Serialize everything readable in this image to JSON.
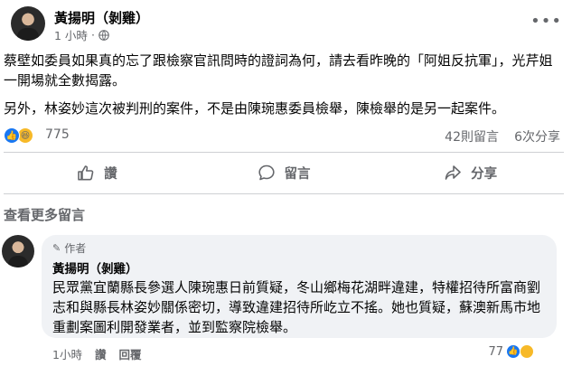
{
  "post": {
    "author": "黃揚明（剝雞）",
    "time": "1 小時",
    "paragraph1": "蔡壁如委員如果真的忘了跟檢察官訊問時的證詞為何，請去看昨晚的「阿姐反抗軍」，光芹姐一開場就全數揭露。",
    "paragraph2": "另外，林姿妙這次被判刑的案件，不是由陳琬惠委員檢舉，陳檢舉的是另一起案件。"
  },
  "reactions": {
    "count": "775",
    "comments": "42則留言",
    "shares": "6次分享"
  },
  "actions": {
    "like": "讚",
    "comment": "留言",
    "share": "分享"
  },
  "view_more": "查看更多留言",
  "comment": {
    "badge": "作者",
    "author": "黃揚明（剝雞）",
    "text": "民眾黨宜蘭縣長參選人陳琬惠日前質疑，冬山鄉梅花湖畔違建，特權招待所富商劉志和與縣長林姿妙關係密切，導致違建招待所屹立不搖。她也質疑，蘇澳新馬市地重劃案圖利開發業者，並到監察院檢舉。",
    "time": "1小時",
    "like": "讚",
    "reply": "回覆",
    "react_count": "77"
  },
  "colors": {
    "accent": "#1877f2",
    "secondary_text": "#65676b",
    "bubble": "#f0f2f5"
  }
}
